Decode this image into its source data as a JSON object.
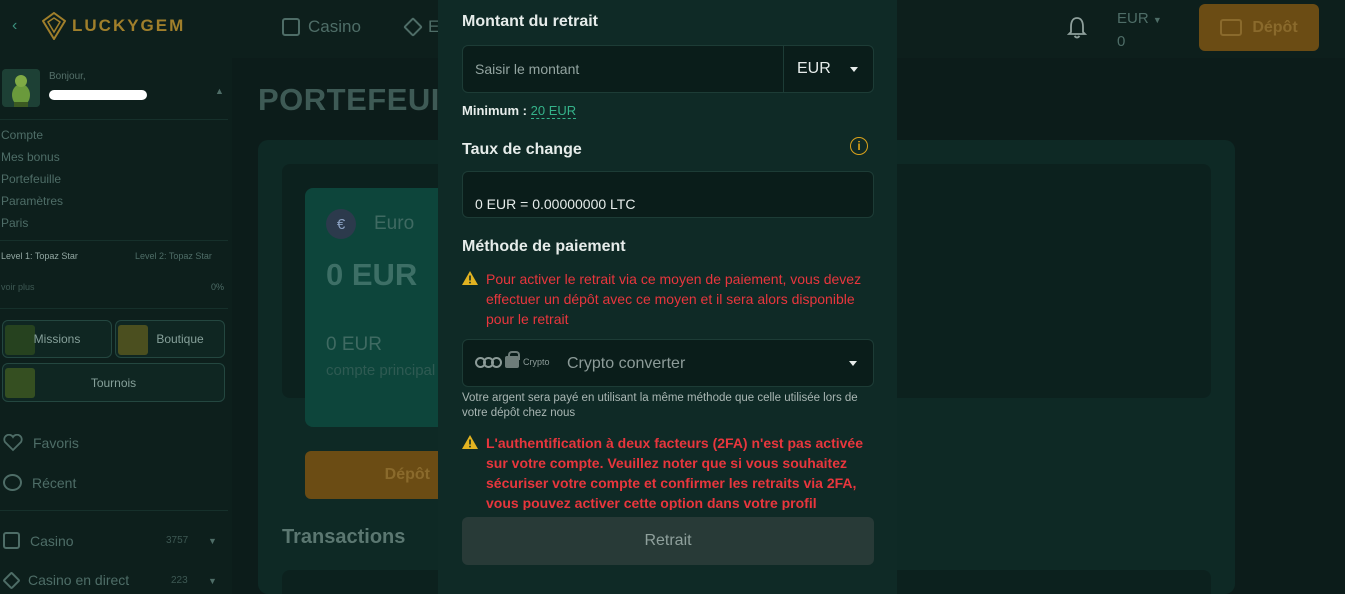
{
  "topbar": {
    "logo_text": "LUCKYGEM",
    "nav": [
      {
        "label": "Casino",
        "icon": "dice-icon"
      },
      {
        "label": "E",
        "icon": "diamond-icon"
      }
    ],
    "currency": "EUR",
    "balance": "0",
    "deposit_label": "Dépôt"
  },
  "sidebar": {
    "hello": "Bonjour,",
    "menu": [
      "Compte",
      "Mes bonus",
      "Portefeuille",
      "Paramètres",
      "Paris"
    ],
    "level1": "Level 1: Topaz Star",
    "level2": "Level 2: Topaz Star",
    "see_more": "voir plus",
    "progress": "0%",
    "tiles": {
      "missions": "Missions",
      "boutique": "Boutique",
      "tournois": "Tournois"
    },
    "favorites": "Favoris",
    "recent": "Récent",
    "casino": {
      "label": "Casino",
      "count": "3757"
    },
    "live": {
      "label": "Casino en direct",
      "count": "223"
    }
  },
  "main": {
    "title": "PORTEFEUILLE",
    "card": {
      "currency_name": "Euro",
      "amount": "0 EUR",
      "sub_amount": "0 EUR",
      "sub_label": "compte principal",
      "symbol": "€"
    },
    "deposit_label": "Dépôt",
    "transactions_title": "Transactions"
  },
  "modal": {
    "amount_label": "Montant du retrait",
    "amount_placeholder": "Saisir le montant",
    "currency": "EUR",
    "minimum_label": "Minimum :",
    "minimum_value": "20 EUR",
    "rate_label": "Taux de change",
    "rate_value": "0 EUR = 0.00000000 LTC",
    "method_label": "Méthode de paiement",
    "warning_method": "Pour activer le retrait via ce moyen de paiement, vous devez effectuer un dépôt avec ce moyen et il sera alors disponible pour le retrait",
    "method_logo_text": "Crypto",
    "method_name": "Crypto converter",
    "note": "Votre argent sera payé en utilisant la même méthode que celle utilisée lors de votre dépôt chez nous",
    "warning_2fa": "L'authentification à deux facteurs (2FA) n'est pas activée sur votre compte. Veuillez noter que si vous souhaitez sécuriser votre compte et confirmer les retraits via 2FA, vous pouvez activer cette option dans votre profil",
    "submit_label": "Retrait"
  },
  "colors": {
    "accent_gold": "#6b4c14",
    "warning_red": "#e8363d",
    "info_yellow": "#d9a21b",
    "link_green": "#35b38a"
  }
}
